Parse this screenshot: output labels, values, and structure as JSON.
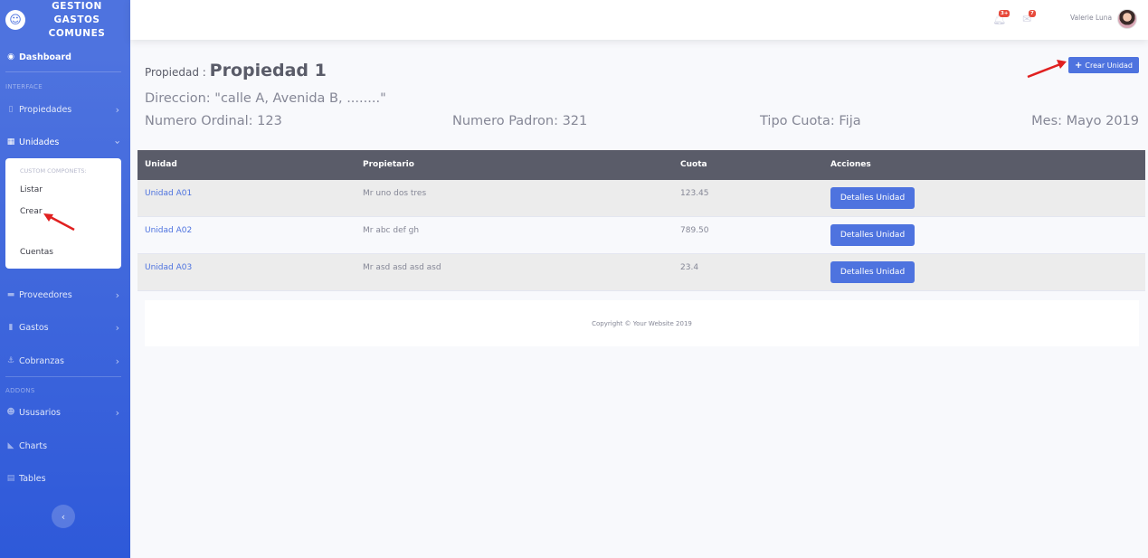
{
  "sidebar": {
    "brand": {
      "logo_icon": "laugh-wink-icon",
      "line1": "GESTION",
      "line2": "GASTOS",
      "line3": "COMUNES"
    },
    "dashboard": "Dashboard",
    "heading_interface": "INTERFACE",
    "propiedades": "Propiedades",
    "unidades": "Unidades",
    "submenu": {
      "heading": "CUSTOM COMPONETS:",
      "items": [
        "Listar",
        "Crear",
        "Cuentas"
      ]
    },
    "proveedores": "Proveedores",
    "gastos": "Gastos",
    "cobranzas": "Cobranzas",
    "heading_addons": "ADDONS",
    "usuarios": "Ususarios",
    "charts": "Charts",
    "tables": "Tables"
  },
  "topbar": {
    "alerts_badge": "3+",
    "messages_badge": "7",
    "user_name": "Valerie Luna"
  },
  "header": {
    "label": "Propiedad :",
    "title": "Propiedad 1",
    "address": "Direccion: \"calle A, Avenida B, ........\"",
    "ordinal": "Numero Ordinal: 123",
    "padron": "Numero Padron: 321",
    "cuota": "Tipo Cuota: Fija",
    "mes": "Mes: Mayo 2019",
    "create_button": "Crear Unidad"
  },
  "table": {
    "headers": [
      "Unidad",
      "Propietario",
      "Cuota",
      "Acciones"
    ],
    "rows": [
      {
        "unidad": "Unidad A01",
        "propietario": "Mr uno dos tres",
        "cuota": "123.45",
        "accion": "Detalles Unidad"
      },
      {
        "unidad": "Unidad A02",
        "propietario": "Mr abc def gh",
        "cuota": "789.50",
        "accion": "Detalles Unidad"
      },
      {
        "unidad": "Unidad A03",
        "propietario": "Mr asd asd asd asd",
        "cuota": "23.4",
        "accion": "Detalles Unidad"
      }
    ]
  },
  "footer": {
    "copyright": "Copyright © Your Website 2019"
  },
  "colors": {
    "primary": "#4e73df",
    "table_header": "#5a5c69",
    "annotation_arrow": "#e02020"
  }
}
